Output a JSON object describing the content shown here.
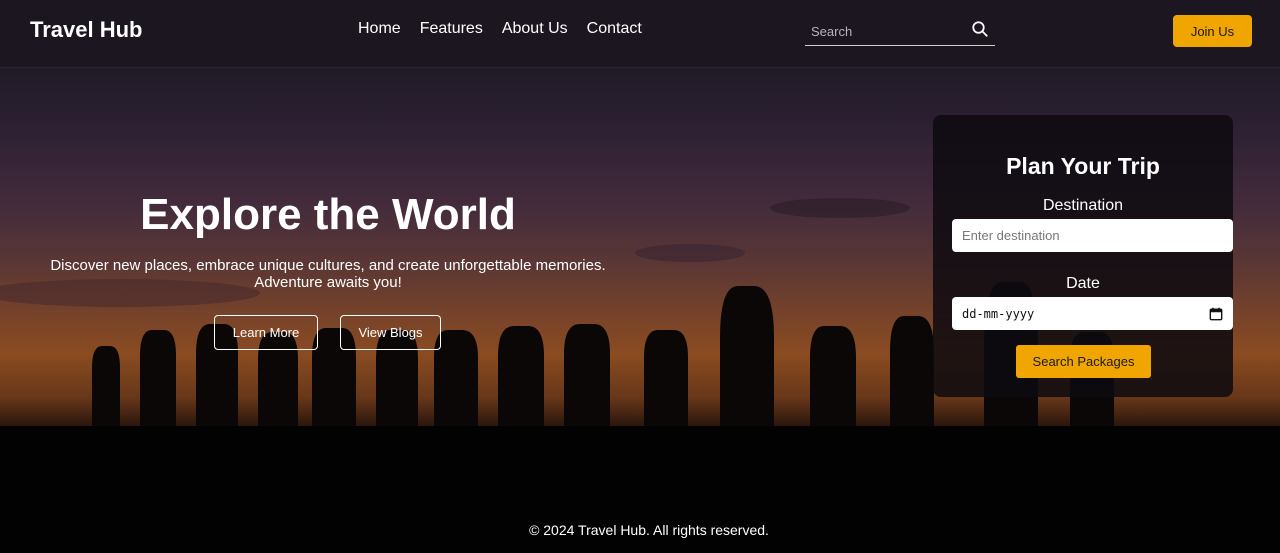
{
  "header": {
    "brand": "Travel Hub",
    "nav": [
      "Home",
      "Features",
      "About Us",
      "Contact"
    ],
    "search_placeholder": "Search",
    "join_label": "Join Us"
  },
  "hero": {
    "title": "Explore the World",
    "subtitle_line1": "Discover new places, embrace unique cultures, and create unforgettable memories.",
    "subtitle_line2": "Adventure awaits you!",
    "learn_more": "Learn More",
    "view_blogs": "View Blogs"
  },
  "plan": {
    "title": "Plan Your Trip",
    "destination_label": "Destination",
    "destination_placeholder": "Enter destination",
    "date_label": "Date",
    "date_value": "dd-mm-yyyy",
    "submit_label": "Search Packages"
  },
  "footer": {
    "text": "© 2024 Travel Hub. All rights reserved."
  },
  "colors": {
    "accent": "#f0a500",
    "header_bg": "#1b1620"
  }
}
